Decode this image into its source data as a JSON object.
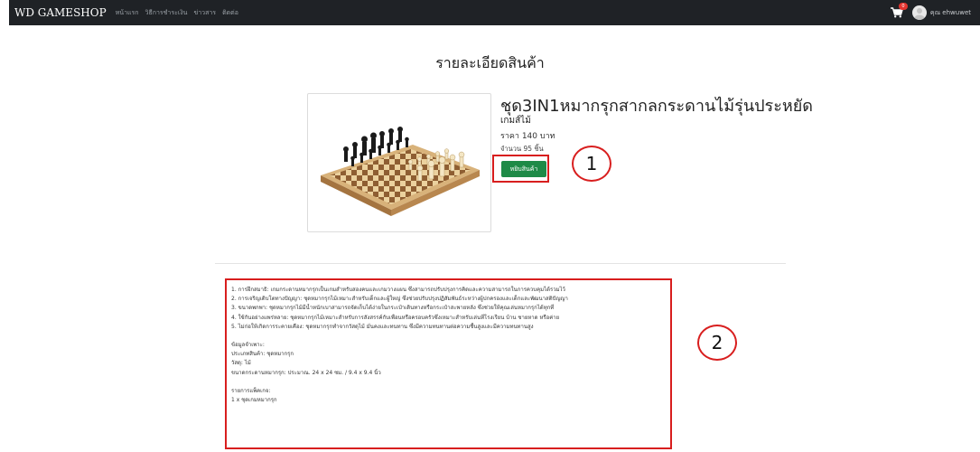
{
  "navbar": {
    "brand": "WD GAMESHOP",
    "items": [
      "หน้าแรก",
      "วิธีการชำระเงิน",
      "ข่าวสาร",
      "ติดต่อ"
    ],
    "cart_count": "0",
    "user_name": "คุณ ehwuwet"
  },
  "page": {
    "title": "รายละเอียดสินค้า"
  },
  "product": {
    "name": "ชุด3IN1หมากรุกสากลกระดานไม้รุ่นประหยัด",
    "category": "เกมส์ไม้",
    "price": "ราคา 140 บาท",
    "quantity": "จำนวน 95 ชิ้น",
    "add_button": "หยิบสินค้า"
  },
  "annotations": {
    "one": "1",
    "two": "2"
  },
  "description": {
    "features": [
      "1. การฝึกสมาธิ: เกมกระดานหมากรุกเป็นเกมสำหรับสองคนและเกมวางแผน ซึ่งสามารถปรับปรุงการคิดและความสามารถในการควบคุมได้รวมไว้",
      "2. การเจริญเติบโตทางปัญญา: ชุดหมากรุกไม้เหมาะสำหรับเด็กและผู้ใหญ่ ซึ่งช่วยปรับปรุงปฏิสัมพันธ์ระหว่างผู้ปกครองและเด็กและพัฒนาสติปัญญา",
      "3. ขนาดพกพา: ชุดหมากรุกไม้มีน้ำหนักเบาสามารถจัดเก็บได้ง่ายในกระเป๋าเดินทางหรือกระเป๋าสะพายหลัง ซึ่งช่วยให้คุณเล่นหมากรุกได้ทุกที่",
      "4. ใช้กันอย่างแพร่หลาย: ชุดหมากรุกไม้เหมาะสำหรับการสังสรรค์กับเพื่อนหรือครอบครัวซึ่งเหมาะสำหรับเล่นที่โรงเรียน บ้าน ชายหาด หรือค่าย",
      "5. ไม่ก่อให้เกิดการระคายเคือง: ชุดหมากรุกทำจากวัสดุไม้ มั่นคงและทนทาน ซึ่งมีความทนทานต่อความชื้นสูงและมีความทนทานสูง"
    ],
    "spec_title": "ข้อมูลจำเพาะ:",
    "specs": [
      "ประเภทสินค้า: ชุดหมากรุก",
      "วัสดุ: ไม้",
      "ขนาดกระดานหมากรุก: ประมาณ. 24 x 24 ซม. / 9.4 x 9.4 นิ้ว"
    ],
    "package_title": "รายการแพ็คเกจ:",
    "package": [
      "1 x ชุดเกมหมากรุก"
    ]
  },
  "colors": {
    "navbar": "#1f2226",
    "button": "#1e8a47",
    "highlight": "#d81e1e"
  },
  "icons": {
    "cart": "cart-icon",
    "avatar": "user-avatar-icon",
    "product_image": "chess-board-image"
  }
}
